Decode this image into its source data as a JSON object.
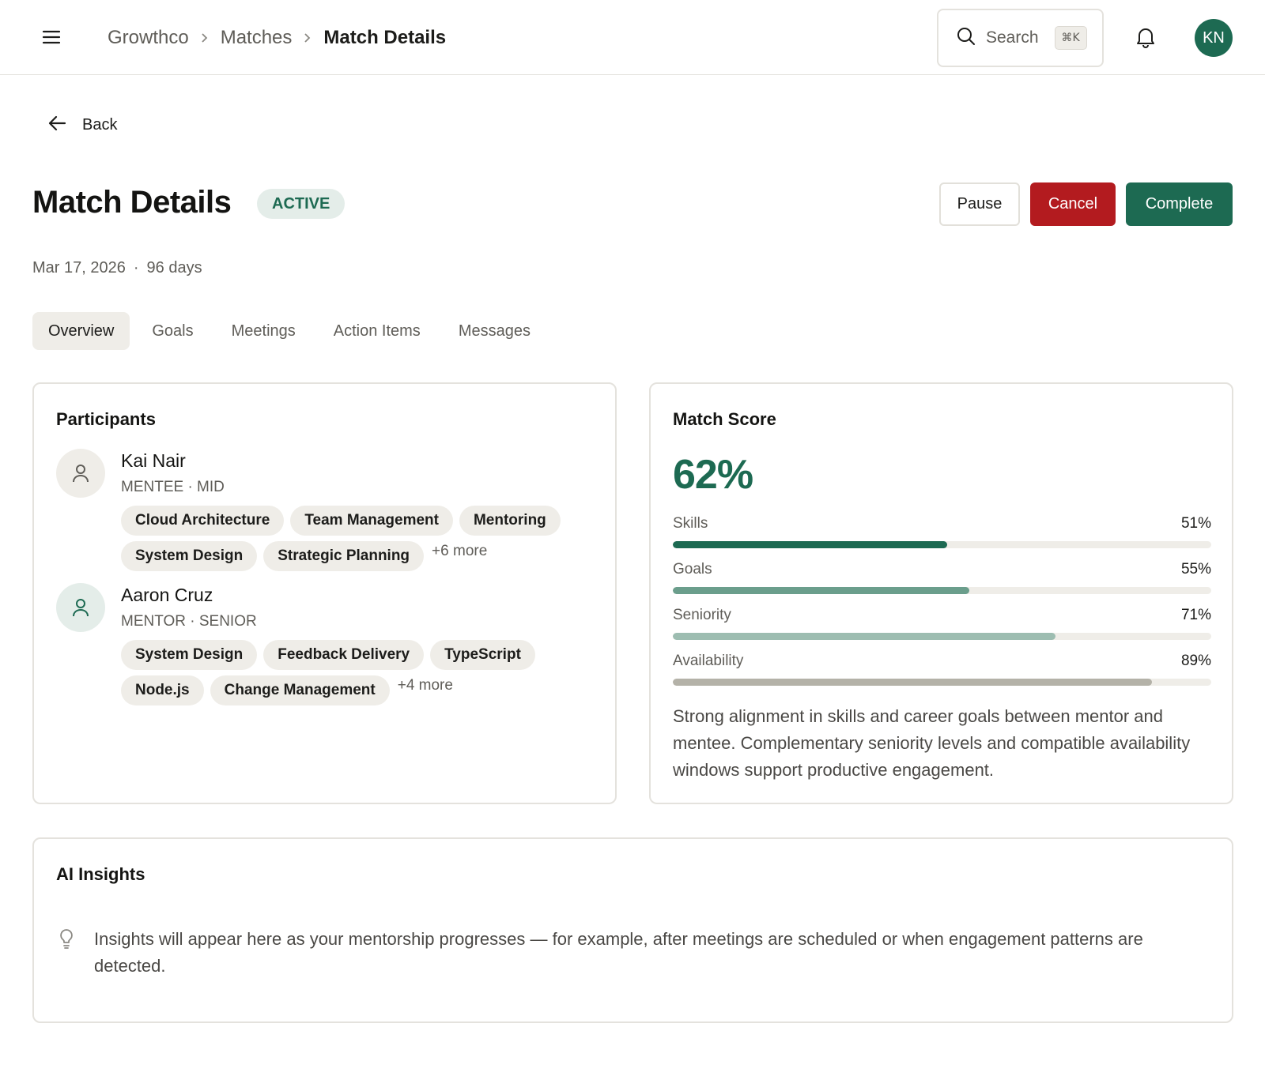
{
  "topbar": {
    "breadcrumbs": [
      "Growthco",
      "Matches",
      "Match Details"
    ],
    "search_label": "Search",
    "search_shortcut": "⌘K",
    "user_initials": "KN"
  },
  "back_label": "Back",
  "header": {
    "title": "Match Details",
    "status": "ACTIVE",
    "date": "Mar 17, 2026",
    "meta_separator": "·",
    "duration": "96 days",
    "actions": {
      "pause": "Pause",
      "cancel": "Cancel",
      "complete": "Complete"
    }
  },
  "tabs": [
    "Overview",
    "Goals",
    "Meetings",
    "Action Items",
    "Messages"
  ],
  "active_tab": "Overview",
  "participants": {
    "title": "Participants",
    "people": [
      {
        "name": "Kai Nair",
        "role": "MENTEE · MID",
        "skills": [
          "Cloud Architecture",
          "Team Management",
          "Mentoring",
          "System Design",
          "Strategic Planning"
        ],
        "more": "+6 more"
      },
      {
        "name": "Aaron Cruz",
        "role": "MENTOR · SENIOR",
        "skills": [
          "System Design",
          "Feedback Delivery",
          "TypeScript",
          "Node.js",
          "Change Management"
        ],
        "more": "+4 more"
      }
    ]
  },
  "match_score": {
    "title": "Match Score",
    "score": "62%",
    "breakdown": [
      {
        "label": "Skills",
        "value": "51%",
        "fraction": 0.51,
        "color": "#1d6a52"
      },
      {
        "label": "Goals",
        "value": "55%",
        "fraction": 0.55,
        "color": "#6b9e8c"
      },
      {
        "label": "Seniority",
        "value": "71%",
        "fraction": 0.71,
        "color": "#9dbdb1"
      },
      {
        "label": "Availability",
        "value": "89%",
        "fraction": 0.89,
        "color": "#b4b2a8"
      }
    ],
    "summary": "Strong alignment in skills and career goals between mentor and mentee. Complementary seniority levels and compatible availability windows support productive engagement."
  },
  "insights": {
    "title": "AI Insights",
    "empty_text": "Insights will appear here as your mentorship progresses — for example, after meetings are scheduled or when engagement patterns are detected."
  },
  "colors": {
    "accent": "#1d6a52",
    "danger": "#b31b1f"
  }
}
